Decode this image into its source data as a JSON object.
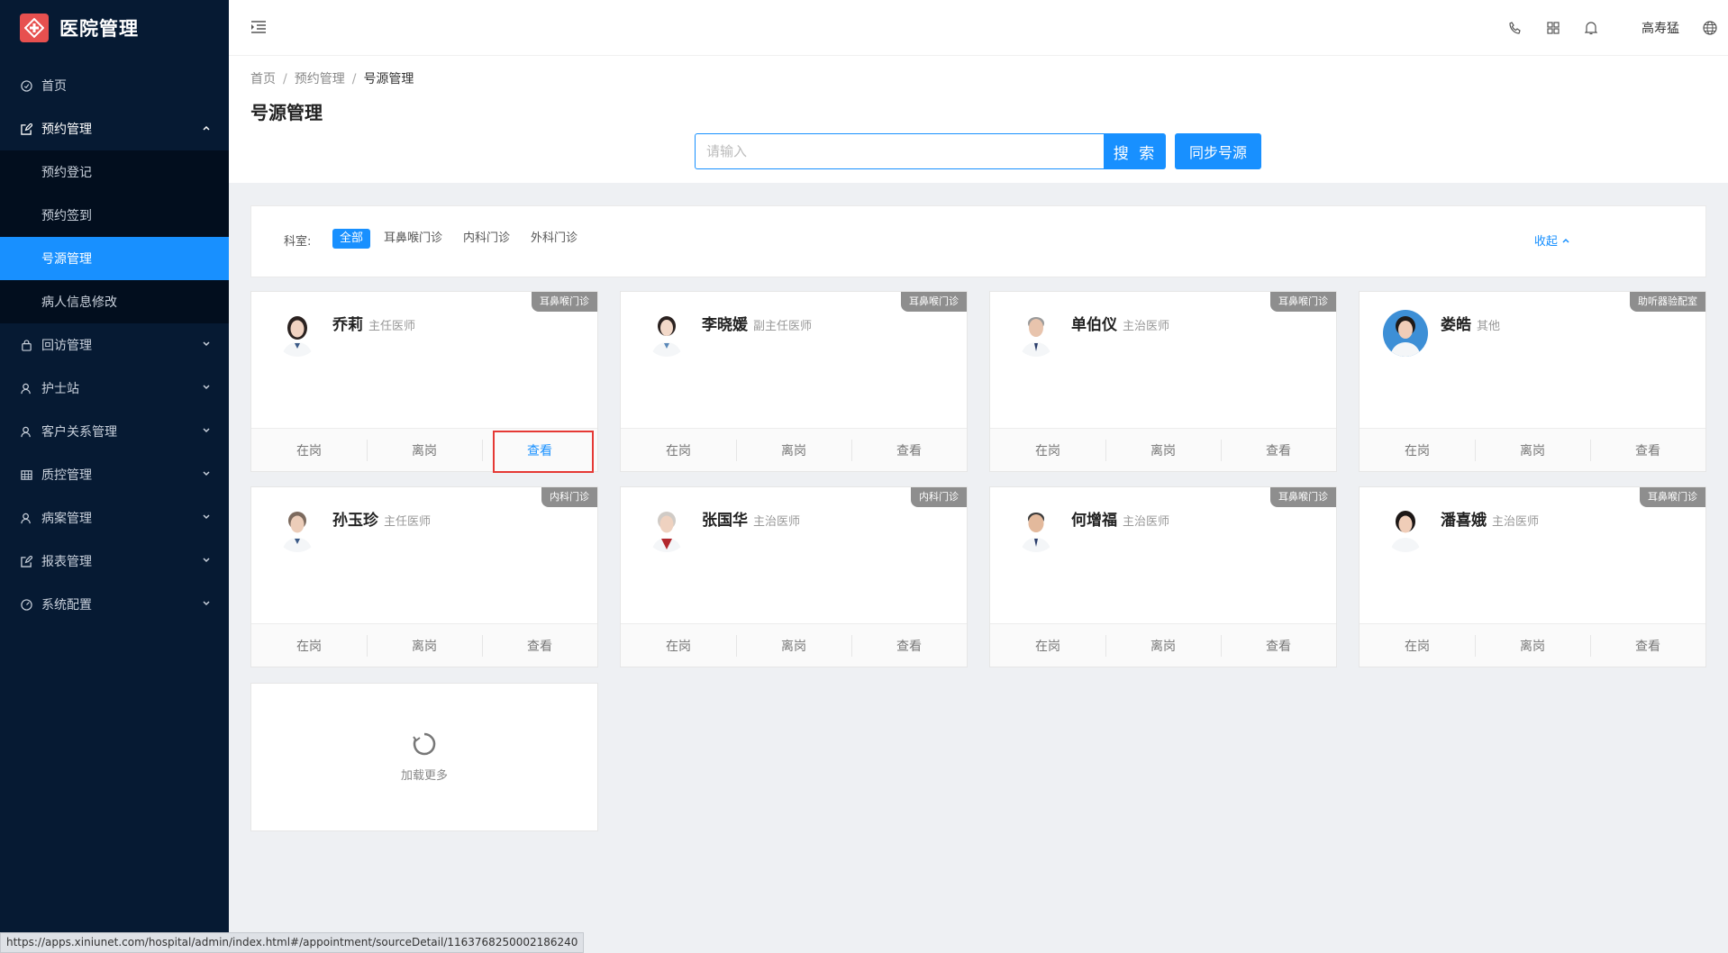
{
  "app": {
    "title": "医院管理"
  },
  "sidebar": {
    "items": [
      {
        "label": "首页"
      },
      {
        "label": "预约管理"
      },
      {
        "label": "回访管理"
      },
      {
        "label": "护士站"
      },
      {
        "label": "客户关系管理"
      },
      {
        "label": "质控管理"
      },
      {
        "label": "病案管理"
      },
      {
        "label": "报表管理"
      },
      {
        "label": "系统配置"
      }
    ],
    "subitems": [
      {
        "label": "预约登记"
      },
      {
        "label": "预约签到"
      },
      {
        "label": "号源管理"
      },
      {
        "label": "病人信息修改"
      }
    ]
  },
  "header": {
    "username": "高寿猛"
  },
  "breadcrumb": {
    "home": "首页",
    "parent": "预约管理",
    "current": "号源管理"
  },
  "page": {
    "title": "号源管理"
  },
  "search": {
    "placeholder": "请输入",
    "button": "搜 索",
    "sync_button": "同步号源"
  },
  "filter": {
    "label": "科室:",
    "tags": [
      "全部",
      "耳鼻喉门诊",
      "内科门诊",
      "外科门诊"
    ],
    "collapse": "收起"
  },
  "actions": {
    "on_duty": "在岗",
    "off_duty": "离岗",
    "view": "查看"
  },
  "doctors": [
    {
      "name": "乔莉",
      "title": "主任医师",
      "dept": "耳鼻喉门诊"
    },
    {
      "name": "李晓媛",
      "title": "副主任医师",
      "dept": "耳鼻喉门诊"
    },
    {
      "name": "单伯仪",
      "title": "主治医师",
      "dept": "耳鼻喉门诊"
    },
    {
      "name": "娄皓",
      "title": "其他",
      "dept": "助听器验配室"
    },
    {
      "name": "孙玉珍",
      "title": "主任医师",
      "dept": "内科门诊"
    },
    {
      "name": "张国华",
      "title": "主治医师",
      "dept": "内科门诊"
    },
    {
      "name": "何增福",
      "title": "主治医师",
      "dept": "耳鼻喉门诊"
    },
    {
      "name": "潘喜娥",
      "title": "主治医师",
      "dept": "耳鼻喉门诊"
    }
  ],
  "load_more": "加载更多",
  "status_url": "https://apps.xiniunet.com/hospital/admin/index.html#/appointment/sourceDetail/1163768250002186240",
  "colors": {
    "sidebar": "#061a33",
    "accent": "#1890ff",
    "highlight": "#e53935"
  }
}
